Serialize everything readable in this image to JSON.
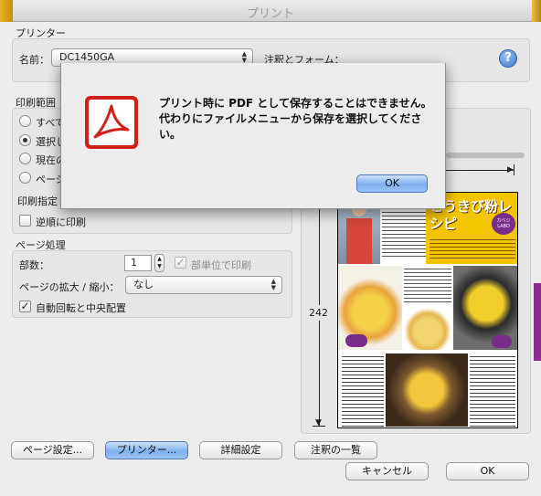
{
  "window": {
    "title": "プリント"
  },
  "printer": {
    "section_label": "プリンター",
    "name_label": "名前：",
    "name_value": "DC1450GA",
    "comments_label": "注釈とフォーム："
  },
  "print_range": {
    "section_label": "印刷範囲",
    "options": [
      "すべて",
      "選択し",
      "現在の",
      "ページ"
    ],
    "selected_index": 1,
    "print_spec_label": "印刷指定",
    "reverse_label": "逆順に印刷"
  },
  "page_handling": {
    "section_label": "ページ処理",
    "copies_label": "部数：",
    "copies_value": "1",
    "collate_label": "部単位で印刷",
    "scaling_label": "ページの拡大 / 縮小：",
    "scaling_value": "なし",
    "auto_rotate_label": "自動回転と中央配置"
  },
  "preview": {
    "height_label": "242",
    "page_title": "とうきび粉レシピ",
    "page_badge": "カベジ LABO"
  },
  "footer": {
    "page_setup": "ページ設定...",
    "printer": "プリンター...",
    "advanced": "詳細設定",
    "comments_summary": "注釈の一覧",
    "cancel": "キャンセル",
    "ok": "OK"
  },
  "alert": {
    "message": "プリント時に PDF として保存することはできません。代わりにファイルメニューから保存を選択してください。",
    "ok": "OK",
    "icon": "adobe-acrobat-icon"
  },
  "colors": {
    "accent_blue": "#7fb0ef",
    "acrobat_red": "#d0201a",
    "magazine_yellow": "#f3c500"
  }
}
